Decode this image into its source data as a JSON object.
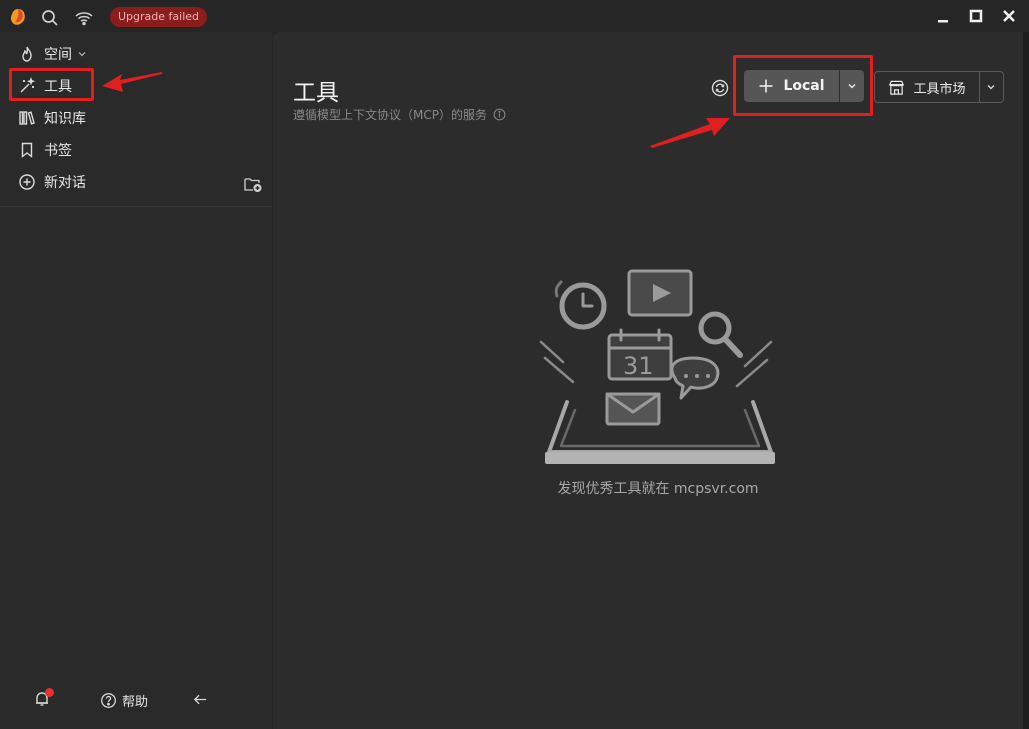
{
  "titlebar": {
    "status_badge": "Upgrade failed",
    "icons": [
      "app-logo-icon",
      "search-icon",
      "wifi-icon",
      "minimize-icon",
      "maximize-icon",
      "close-icon"
    ]
  },
  "sidebar": {
    "items": [
      {
        "label": "空间",
        "icon": "flame-icon"
      },
      {
        "label": "工具",
        "icon": "magic-wand-icon"
      },
      {
        "label": "知识库",
        "icon": "library-icon"
      },
      {
        "label": "书签",
        "icon": "bookmark-icon"
      },
      {
        "label": "新对话",
        "icon": "plus-circle-icon"
      }
    ],
    "bottom": {
      "help_label": "帮助"
    }
  },
  "main": {
    "title": "工具",
    "subtitle": "遵循模型上下文协议（MCP）的服务",
    "local_button": "Local",
    "market_button": "工具市场",
    "empty_text": "发现优秀工具就在 mcpsvr.com"
  },
  "colors": {
    "highlight": "#e02020",
    "accent_red": "#e5322d",
    "badge_bg": "#8c1d1d"
  }
}
